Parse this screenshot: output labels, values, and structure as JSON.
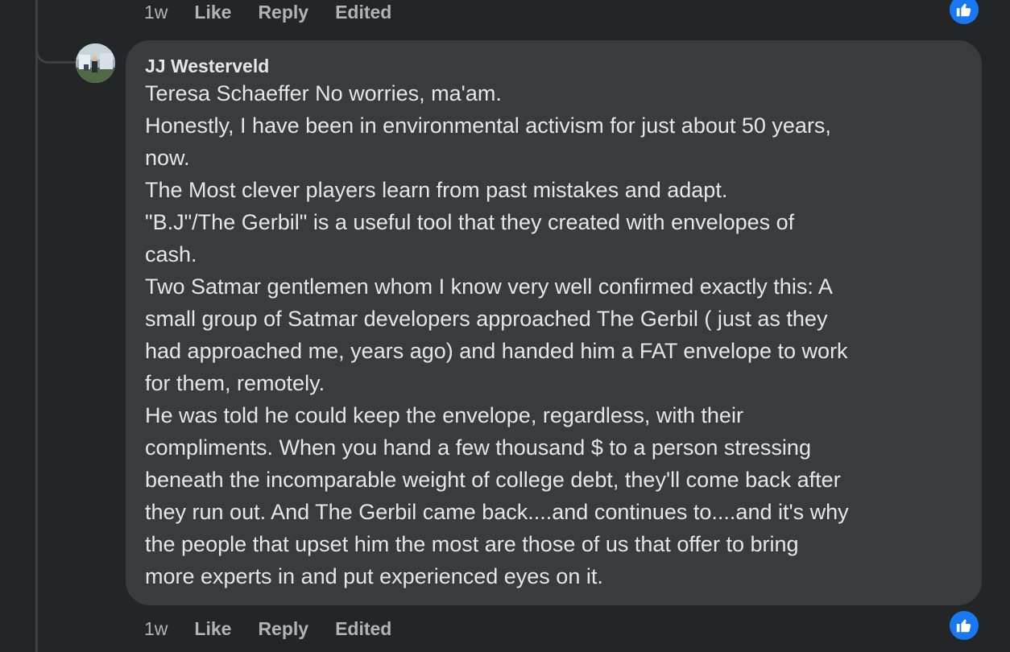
{
  "top_actions": {
    "time": "1w",
    "like": "Like",
    "reply": "Reply",
    "edited": "Edited"
  },
  "comment": {
    "author": "JJ Westerveld",
    "lines": [
      "Teresa Schaeffer No worries, ma'am.",
      "Honestly, I have been in environmental activism for just about 50 years,",
      "now.",
      "The Most clever players learn from past mistakes and adapt.",
      "\"B.J\"/The Gerbil\" is a useful tool that they created with envelopes of",
      "cash.",
      "Two Satmar gentlemen whom I know very well confirmed exactly this: A",
      "small group of Satmar developers approached The Gerbil ( just as they",
      "had approached me, years ago) and handed him a FAT envelope to work",
      "for them, remotely.",
      "He was told he could keep the envelope, regardless, with their",
      "compliments. When you hand a few thousand $ to a person stressing",
      "beneath the incomparable weight of college debt, they'll come back after",
      "they run out. And The Gerbil came back....and continues to....and it's why",
      "the people that upset him the most are those of us that offer to bring",
      "more experts in and put experienced eyes on it."
    ]
  },
  "bottom_actions": {
    "time": "1w",
    "like": "Like",
    "reply": "Reply",
    "edited": "Edited"
  },
  "icons": {
    "reaction": "thumbs-up-icon",
    "avatar": "avatar"
  },
  "colors": {
    "background": "#242526",
    "bubble": "#3a3b3c",
    "text": "#e4e6eb",
    "muted": "#b0b3b8",
    "accent": "#1877f2"
  }
}
